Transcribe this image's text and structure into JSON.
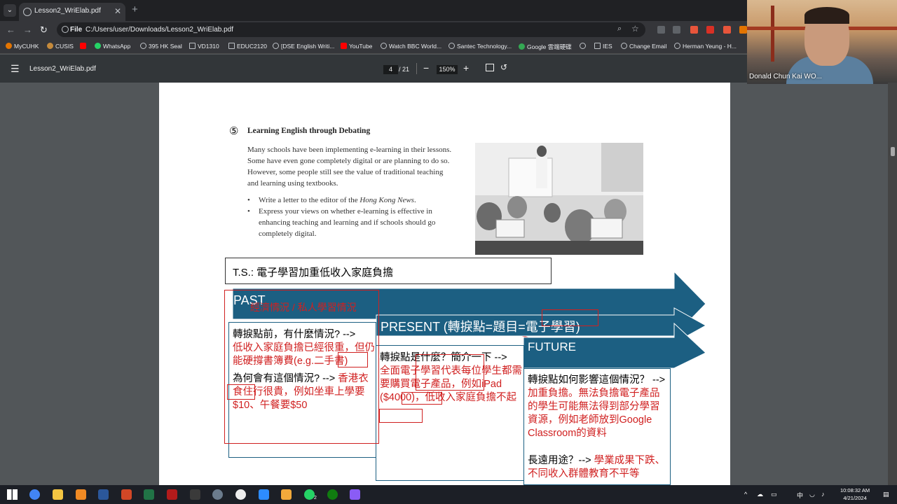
{
  "browser": {
    "tab_title": "Lesson2_WriElab.pdf",
    "omnibox_label": "File",
    "url": "C:/Users/user/Downloads/Lesson2_WriElab.pdf",
    "bookmarks": [
      "MyCUHK",
      "CUSIS",
      "",
      "WhatsApp",
      "395 HK Seal",
      "VD1310",
      "EDUC2120",
      "[DSE English Writi...",
      "YouTube",
      "Watch BBC World...",
      "Santec Technology...",
      "Google 雲端硬碟",
      "",
      "IES",
      "Change Email",
      "Herman Yeung - H..."
    ]
  },
  "pdf_toolbar": {
    "filename": "Lesson2_WriElab.pdf",
    "page": "4",
    "total": "/ 21",
    "zoom": "150%"
  },
  "webcam": {
    "name": "Donald Chun Kai WO..."
  },
  "document": {
    "task_number": "⑤",
    "task_title": "Learning English through Debating",
    "para1": "Many schools have been implementing e-learning in their lessons. Some have even gone completely digital or are planning to do so. However, some people still see the value of traditional teaching and learning using textbooks.",
    "bullet1_pre": "Write a letter to the editor of the ",
    "bullet1_em": "Hong Kong News",
    "bullet1_post": ".",
    "bullet2": "Express your views on whether e-learning is effective in enhancing teaching and learning and if schools should go completely digital."
  },
  "annotation": {
    "ts": "T.S.: 電子學習加重低收入家庭負擔",
    "past_label": "PAST",
    "past_overlay": "經濟情況 / 私人學習情況",
    "present_label": "PRESENT (轉捩點=題目=電子學習)",
    "future_label": "FUTURE",
    "past_q1": "轉捩點前，有什麼情況? -->",
    "past_a1": "低收入家庭負擔已經很重，但仍能硬撐書簿費(e.g.二手書)",
    "past_q2": "為何會有這個情況? -->",
    "past_a2": "香港衣食住行很貴，例如坐車上學要$10、午餐要$50",
    "present_q": "轉捩點是什麼？簡介一下 -->",
    "present_a": "全面電子學習代表每位學生都需要購買電子產品，例如iPad ($4000)，低收入家庭負擔不起",
    "future_q1": "轉捩點如何影響這個情況？ -->",
    "future_a1": "加重負擔。無法負擔電子產品的學生可能無法得到部分學習資源，例如老師放到Google Classroom的資料",
    "future_q2": "長遠用途？-->",
    "future_a2": "學業成果下跌、不同收入群體教育不平等"
  },
  "taskbar": {
    "time": "10:08:32 AM",
    "date": "4/21/2024",
    "ime": "中",
    "whatsapp_badge": "2"
  },
  "colors": {
    "arrow": "#1c5f82",
    "annotation_red": "#d02020"
  }
}
